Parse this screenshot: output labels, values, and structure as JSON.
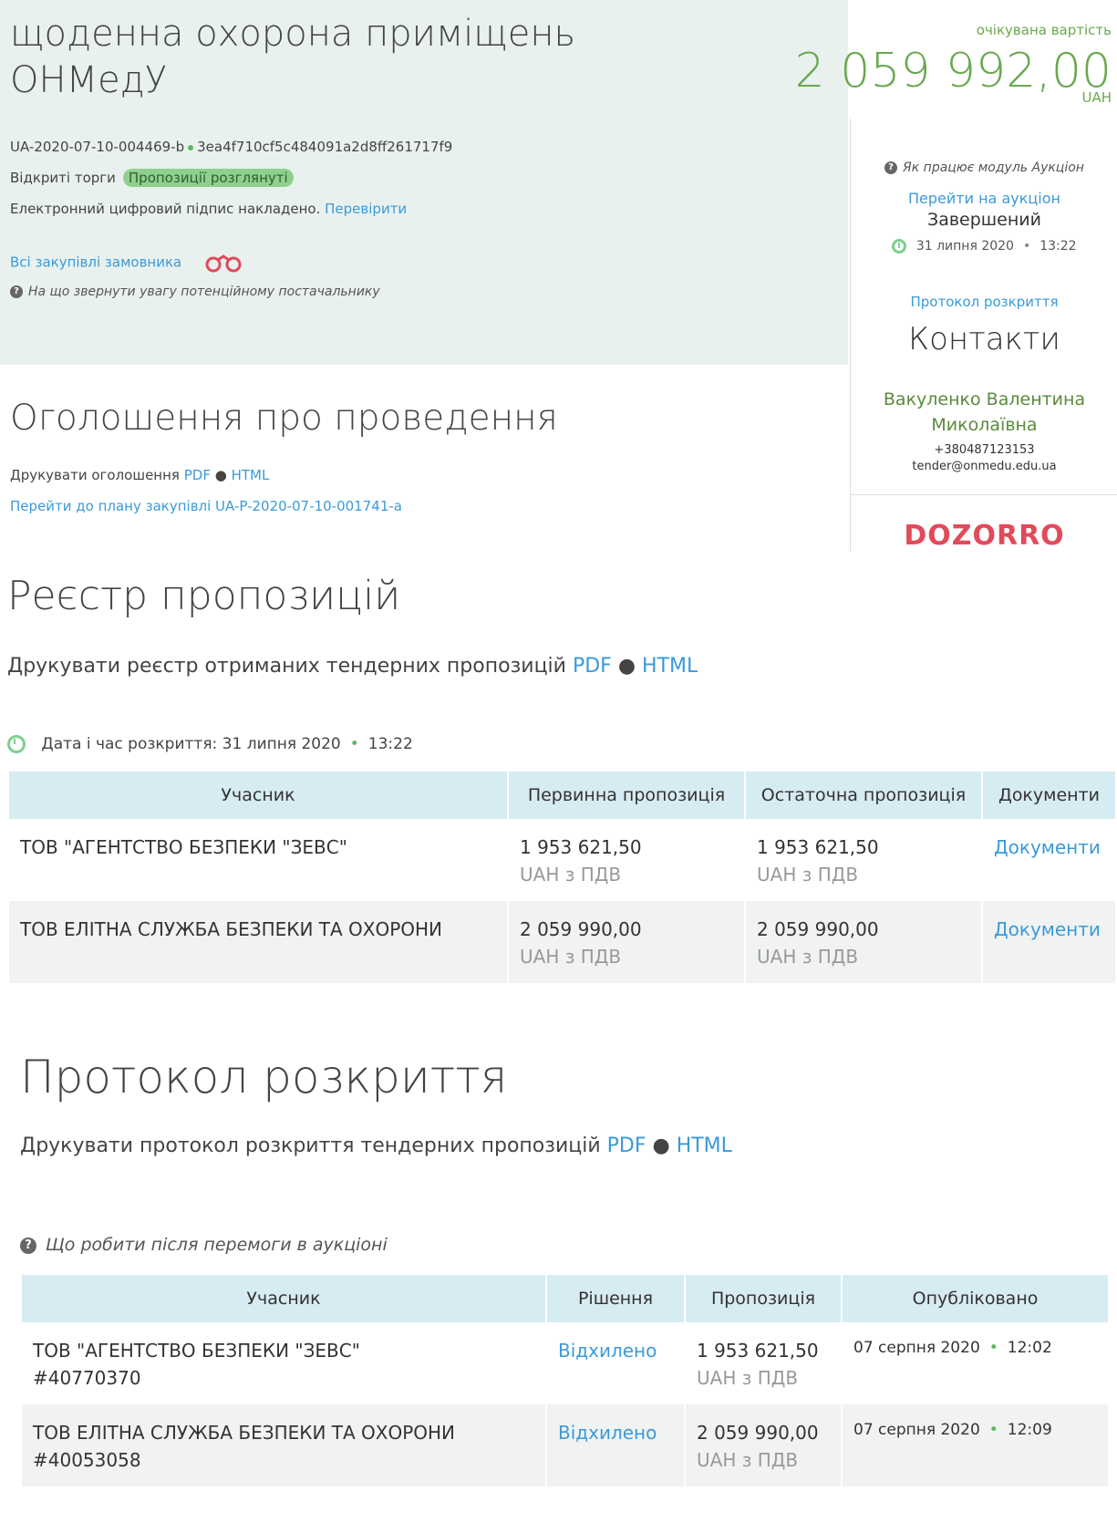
{
  "header": {
    "title_line1": "щоденна охорона приміщень",
    "title_line2": "ОНМедУ",
    "price_label": "очікувана вартість",
    "price": "2 059 992,00",
    "currency": "UAH",
    "tender_id": "UA-2020-07-10-004469-b",
    "hash": "3ea4f710cf5c484091a2d8ff261717f9",
    "procedure": "Відкриті торги",
    "status_badge": "Пропозиції розглянуті",
    "signature_text": "Електронний цифровий підпис накладено.",
    "signature_link": "Перевірити",
    "all_purchases_link": "Всі закупівлі замовника",
    "attention_text": "На що звернути увагу потенційному постачальнику"
  },
  "sidebar": {
    "auction_help": "Як працює модуль Аукціон",
    "go_to_auction": "Перейти на аукціон",
    "auction_status": "Завершений",
    "auction_date": "31 липня 2020",
    "auction_time": "13:22",
    "protocol_link": "Протокол розкриття",
    "contacts_title": "Контакти",
    "contact_name_1": "Вакуленко Валентина",
    "contact_name_2": "Миколаївна",
    "phone": "+380487123153",
    "email": "tender@onmedu.edu.ua",
    "dozorro": "DOZORRO"
  },
  "announcement": {
    "title": "Оголошення про проведення",
    "print_label": "Друкувати оголошення",
    "pdf": "PDF",
    "html": "HTML",
    "plan_link": "Перейти до плану закупівлі UA-P-2020-07-10-001741-a"
  },
  "registry": {
    "title": "Реєстр пропозицій",
    "print_label": "Друкувати реєстр отриманих тендерних пропозицій",
    "pdf": "PDF",
    "html": "HTML",
    "opening_label": "Дата і час розкриття: 31 липня 2020",
    "opening_time": "13:22",
    "columns": [
      "Учасник",
      "Первинна пропозиція",
      "Остаточна пропозиція",
      "Документи"
    ],
    "rows": [
      {
        "participant": "ТОВ \"АГЕНТСТВО БЕЗПЕКИ \"ЗЕВС\"",
        "initial": "1 953 621,50",
        "final": "1 953 621,50",
        "vat": "UAH з ПДВ",
        "docs": "Документи"
      },
      {
        "participant": "ТОВ ЕЛІТНА СЛУЖБА БЕЗПЕКИ ТА ОХОРОНИ",
        "initial": "2 059 990,00",
        "final": "2 059 990,00",
        "vat": "UAH з ПДВ",
        "docs": "Документи"
      }
    ]
  },
  "protocol": {
    "title": "Протокол розкриття",
    "print_label": "Друкувати протокол розкриття тендерних пропозицій",
    "pdf": "PDF",
    "html": "HTML",
    "after_win": "Що робити після перемоги в аукціоні",
    "columns": [
      "Учасник",
      "Рішення",
      "Пропозиція",
      "Опубліковано"
    ],
    "rows": [
      {
        "participant": "ТОВ \"АГЕНТСТВО БЕЗПЕКИ \"ЗЕВС\"",
        "code": "#40770370",
        "decision": "Відхилено",
        "offer": "1 953 621,50",
        "vat": "UAH з ПДВ",
        "date": "07 серпня 2020",
        "time": "12:02"
      },
      {
        "participant": "ТОВ ЕЛІТНА СЛУЖБА БЕЗПЕКИ ТА ОХОРОНИ",
        "code": "#40053058",
        "decision": "Відхилено",
        "offer": "2 059 990,00",
        "vat": "UAH з ПДВ",
        "date": "07 серпня 2020",
        "time": "12:09"
      }
    ]
  }
}
